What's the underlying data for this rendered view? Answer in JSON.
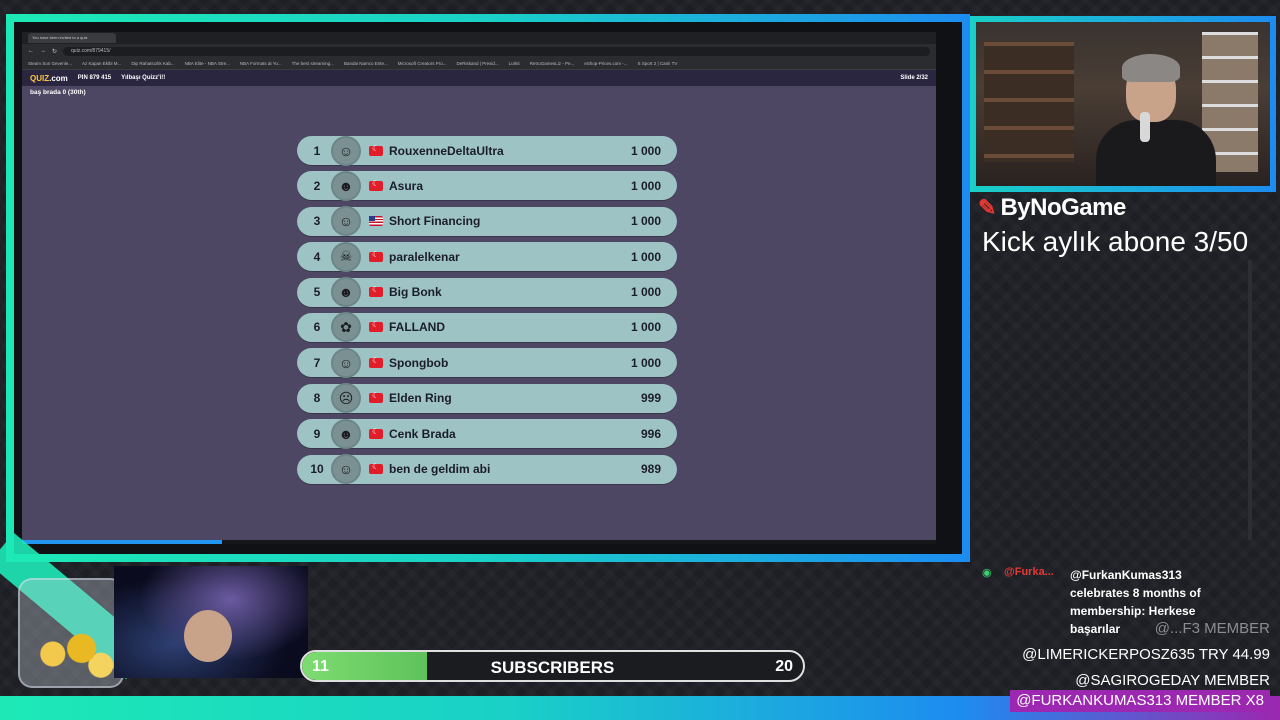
{
  "browser": {
    "tab_title": "You have been invited to a quiz",
    "url": "quiz.com/879415/",
    "bookmarks": [
      "Steam Son Gevenle...",
      "Az Kapan Ekibi M...",
      "Dip Rahatsızlık Kab...",
      "NBA Elite - NBA Stre...",
      "NBA Formats at Yo...",
      "The best streaming...",
      "Bandai Namco Ente...",
      "Microsoft Creators Pro...",
      "DeRiskand | Presid...",
      "Lurkit",
      "RetroGamesLiz - Pe...",
      "eShop-Prices.com -...",
      "S Sport 2 | Canlı TV"
    ]
  },
  "quiz": {
    "logo_main": "QUIZ",
    "logo_suffix": ".com",
    "pin": "PIN 879 415",
    "title": "Yılbaşı Quizz'i!!",
    "slide": "Slide 2/32",
    "player_line": "baş brada    0 (30th)",
    "leaderboard": [
      {
        "rank": "1",
        "name": "RouxenneDeltaUltra",
        "score": "1 000",
        "flag": "tr"
      },
      {
        "rank": "2",
        "name": "Asura",
        "score": "1 000",
        "flag": "tr"
      },
      {
        "rank": "3",
        "name": "Short Financing",
        "score": "1 000",
        "flag": "us"
      },
      {
        "rank": "4",
        "name": "paralelkenar",
        "score": "1 000",
        "flag": "tr"
      },
      {
        "rank": "5",
        "name": "Big Bonk",
        "score": "1 000",
        "flag": "tr"
      },
      {
        "rank": "6",
        "name": "FALLAND",
        "score": "1 000",
        "flag": "tr"
      },
      {
        "rank": "7",
        "name": "Spongbob",
        "score": "1 000",
        "flag": "tr"
      },
      {
        "rank": "8",
        "name": "Elden Ring",
        "score": "999",
        "flag": "tr"
      },
      {
        "rank": "9",
        "name": "Cenk Brada",
        "score": "996",
        "flag": "tr"
      },
      {
        "rank": "10",
        "name": "ben de geldim abi",
        "score": "989",
        "flag": "tr"
      }
    ]
  },
  "stream": {
    "brand": "ByNoGame",
    "kick_text": "Kick aylık abone 3/50",
    "chat": {
      "user": "@Furka...",
      "message": "@FurkanKumas313 celebrates 8 months of membership: Herkese başarılar"
    },
    "events": [
      {
        "text": "@...F3   MEMBER"
      },
      {
        "text": "@LIMERICKERPOSZ635   TRY 44.99"
      },
      {
        "text": "@SAGIROGEDAY   MEMBER"
      },
      {
        "text": "@FURKANKUMAS313   MEMBER X8"
      }
    ],
    "subs": {
      "start": "11",
      "label": "SUBSCRIBERS",
      "end": "20",
      "progress": 0.25
    }
  }
}
